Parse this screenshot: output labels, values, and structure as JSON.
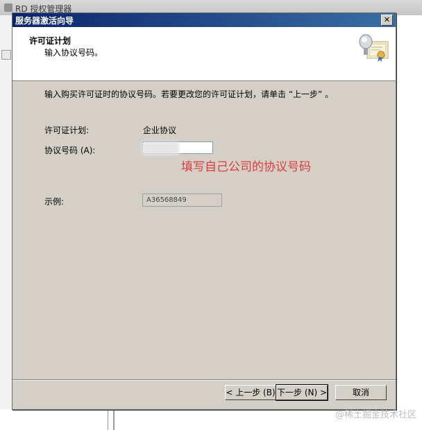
{
  "background_window": {
    "title": "RD 授权管理器"
  },
  "dialog": {
    "title": "服务器激活向导",
    "close_glyph": "✕"
  },
  "header": {
    "title": "许可证计划",
    "subtitle": "输入协议号码。",
    "icon": "certificate-icon"
  },
  "content": {
    "instruction": "输入购买许可证时的协议号码。若要更改您的许可证计划，请单击 “上一步” 。",
    "plan_label": "许可证计划:",
    "plan_value": "企业协议",
    "number_label": "协议号码 (A):",
    "number_value": "",
    "annotation": "填写自己公司的协议号码",
    "example_label": "示例:",
    "example_value": "A36568849"
  },
  "buttons": {
    "back": "< 上一步 (B)",
    "next": "下一步 (N) >",
    "cancel": "取消"
  },
  "watermark": "@稀土掘金技术社区",
  "colors": {
    "title_gradient_start": "#0a246a",
    "title_gradient_end": "#3a6ea5",
    "dialog_face": "#d4d0c8",
    "annotation": "#e03a3a"
  }
}
